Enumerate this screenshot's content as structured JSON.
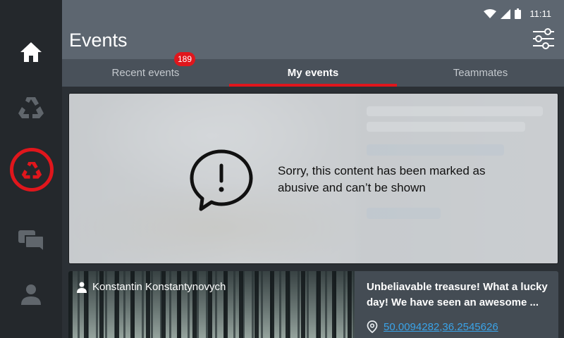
{
  "status_bar": {
    "time": "11:11",
    "icons": [
      "wifi-icon",
      "signal-icon",
      "battery-icon"
    ]
  },
  "header": {
    "title": "Events",
    "filter_icon": "sliders-icon"
  },
  "tabs": [
    {
      "label": "Recent events",
      "badge": "189"
    },
    {
      "label": "My events",
      "active": true
    },
    {
      "label": "Teammates"
    }
  ],
  "sidebar": {
    "items": [
      {
        "icon": "home-icon"
      },
      {
        "icon": "recycle-icon"
      },
      {
        "icon": "recycle-icon",
        "active": true
      },
      {
        "icon": "chat-icon"
      },
      {
        "icon": "user-icon"
      }
    ]
  },
  "blocked_card": {
    "message": "Sorry, this content has been marked as abusive and can’t be shown"
  },
  "event_card": {
    "author": "Konstantin Konstantynovych",
    "title": "Unbeliavable treasure! What a lucky day! We have seen an awesome ...",
    "location": "50.0094282,36.2545626"
  },
  "colors": {
    "accent": "#e0161c",
    "header": "#5d6670",
    "link": "#3aa3e8"
  }
}
